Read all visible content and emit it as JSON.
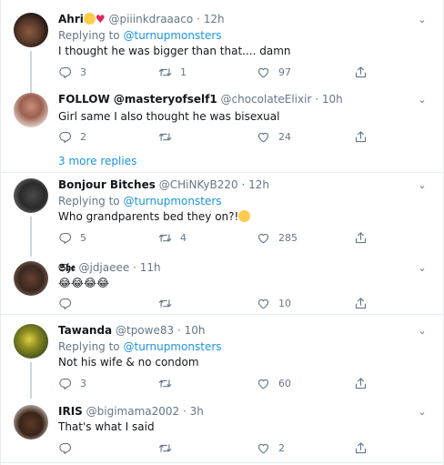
{
  "colors": {
    "accent": "#1b95e0",
    "muted": "#657786",
    "text": "#14171a",
    "border": "#e6ecf0"
  },
  "icons": {
    "reply": "reply-icon",
    "retweet": "retweet-icon",
    "like": "heart-icon",
    "share": "share-icon",
    "more": "chevron-down-icon"
  },
  "more_replies": "3 more replies",
  "tweets": [
    {
      "name": "Ahri",
      "handle": "@piiinkdraaaco",
      "time": "12h",
      "replying_to": "@turnupmonsters",
      "text": "I thought he was bigger than that.... damn",
      "replies": "3",
      "retweets": "1",
      "likes": "97"
    },
    {
      "name": "FOLLOW @masteryofself1",
      "handle": "@chocolateElixir",
      "time": "10h",
      "text": "Girl same I also thought he was bisexual",
      "replies": "2",
      "retweets": "",
      "likes": "24"
    },
    {
      "name": "Bonjour Bitches",
      "handle": "@CHiNKyB220",
      "time": "12h",
      "replying_to": "@turnupmonsters",
      "text": "Who grandparents bed they on?!",
      "replies": "5",
      "retweets": "4",
      "likes": "285"
    },
    {
      "name": "𝕾𝖍𝖊",
      "handle": "@jdjaeee",
      "time": "11h",
      "text": "😂😂😂😂",
      "replies": "",
      "retweets": "",
      "likes": "10"
    },
    {
      "name": "Tawanda",
      "handle": "@tpowe83",
      "time": "10h",
      "replying_to": "@turnupmonsters",
      "text": "Not his wife & no condom",
      "replies": "3",
      "retweets": "",
      "likes": "60"
    },
    {
      "name": "IRIS",
      "handle": "@bigimama2002",
      "time": "3h",
      "text": "That's what I said",
      "replies": "",
      "retweets": "",
      "likes": "2"
    }
  ],
  "labels": {
    "replying_prefix": "Replying to",
    "dot": "·"
  }
}
